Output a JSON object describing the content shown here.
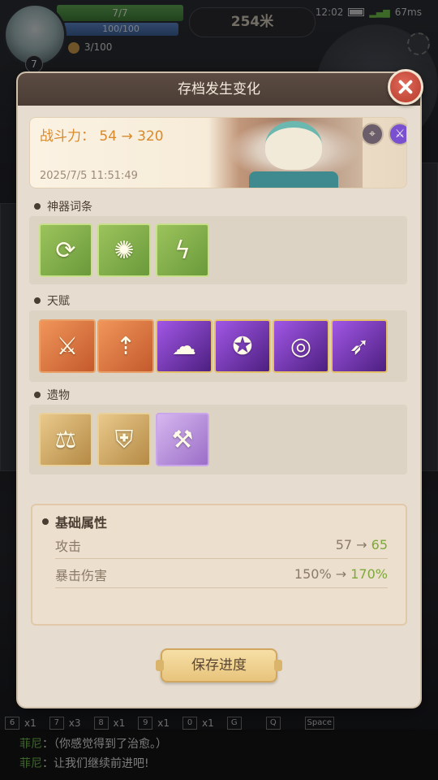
{
  "hud": {
    "hp_text": "7/7",
    "hp_fraction": 1.0,
    "mp_text": "100/100",
    "mp_fraction": 1.0,
    "xp_text": "3/100",
    "level": "7",
    "distance": "254米",
    "time": "12:02",
    "ping": "67ms"
  },
  "hotbar": [
    {
      "key": "6",
      "count": "x1"
    },
    {
      "key": "7",
      "count": "x3"
    },
    {
      "key": "8",
      "count": "x1"
    },
    {
      "key": "9",
      "count": "x1"
    },
    {
      "key": "0",
      "count": "x1"
    },
    {
      "key": "G",
      "count": ""
    },
    {
      "key": "Q",
      "count": ""
    },
    {
      "key": "Space",
      "count": ""
    }
  ],
  "chat": [
    {
      "name": "菲尼",
      "sep": "：",
      "text": "（你感觉得到了治愈。）"
    },
    {
      "name": "菲尼",
      "sep": "：",
      "text": "让我们继续前进吧!"
    }
  ],
  "modal": {
    "title": "存档发生变化",
    "power_label": "战斗力：",
    "power_from": "54",
    "power_arrow": "→",
    "power_to": "320",
    "timestamp": "2025/7/5 11:51:49"
  },
  "sections": {
    "artifacts_title": "神器词条",
    "artifacts": [
      "green-swirl-icon",
      "green-flower-icon",
      "green-lightning-icon"
    ],
    "talents_title": "天赋",
    "talents": [
      "orange-sword-icon",
      "orange-arrow-icon",
      "purple-shadow-icon",
      "purple-magic-circle-icon",
      "purple-slash-icon",
      "purple-dash-icon"
    ],
    "relics_title": "遗物",
    "relics": [
      "golden-scale-icon",
      "steel-helmet-icon",
      "silver-axe-icon"
    ]
  },
  "stats": {
    "title": "基础属性",
    "rows": [
      {
        "label": "攻击",
        "from": "57",
        "arrow": "→",
        "to": "65"
      },
      {
        "label": "暴击伤害",
        "from": "150%",
        "arrow": "→",
        "to": "170%"
      }
    ]
  },
  "save_label": "保存进度",
  "colors": {
    "accent_orange": "#d88a2c",
    "increase_green": "#7da83a",
    "header_brown": "#5b4b42",
    "close_red": "#c94a3a"
  }
}
